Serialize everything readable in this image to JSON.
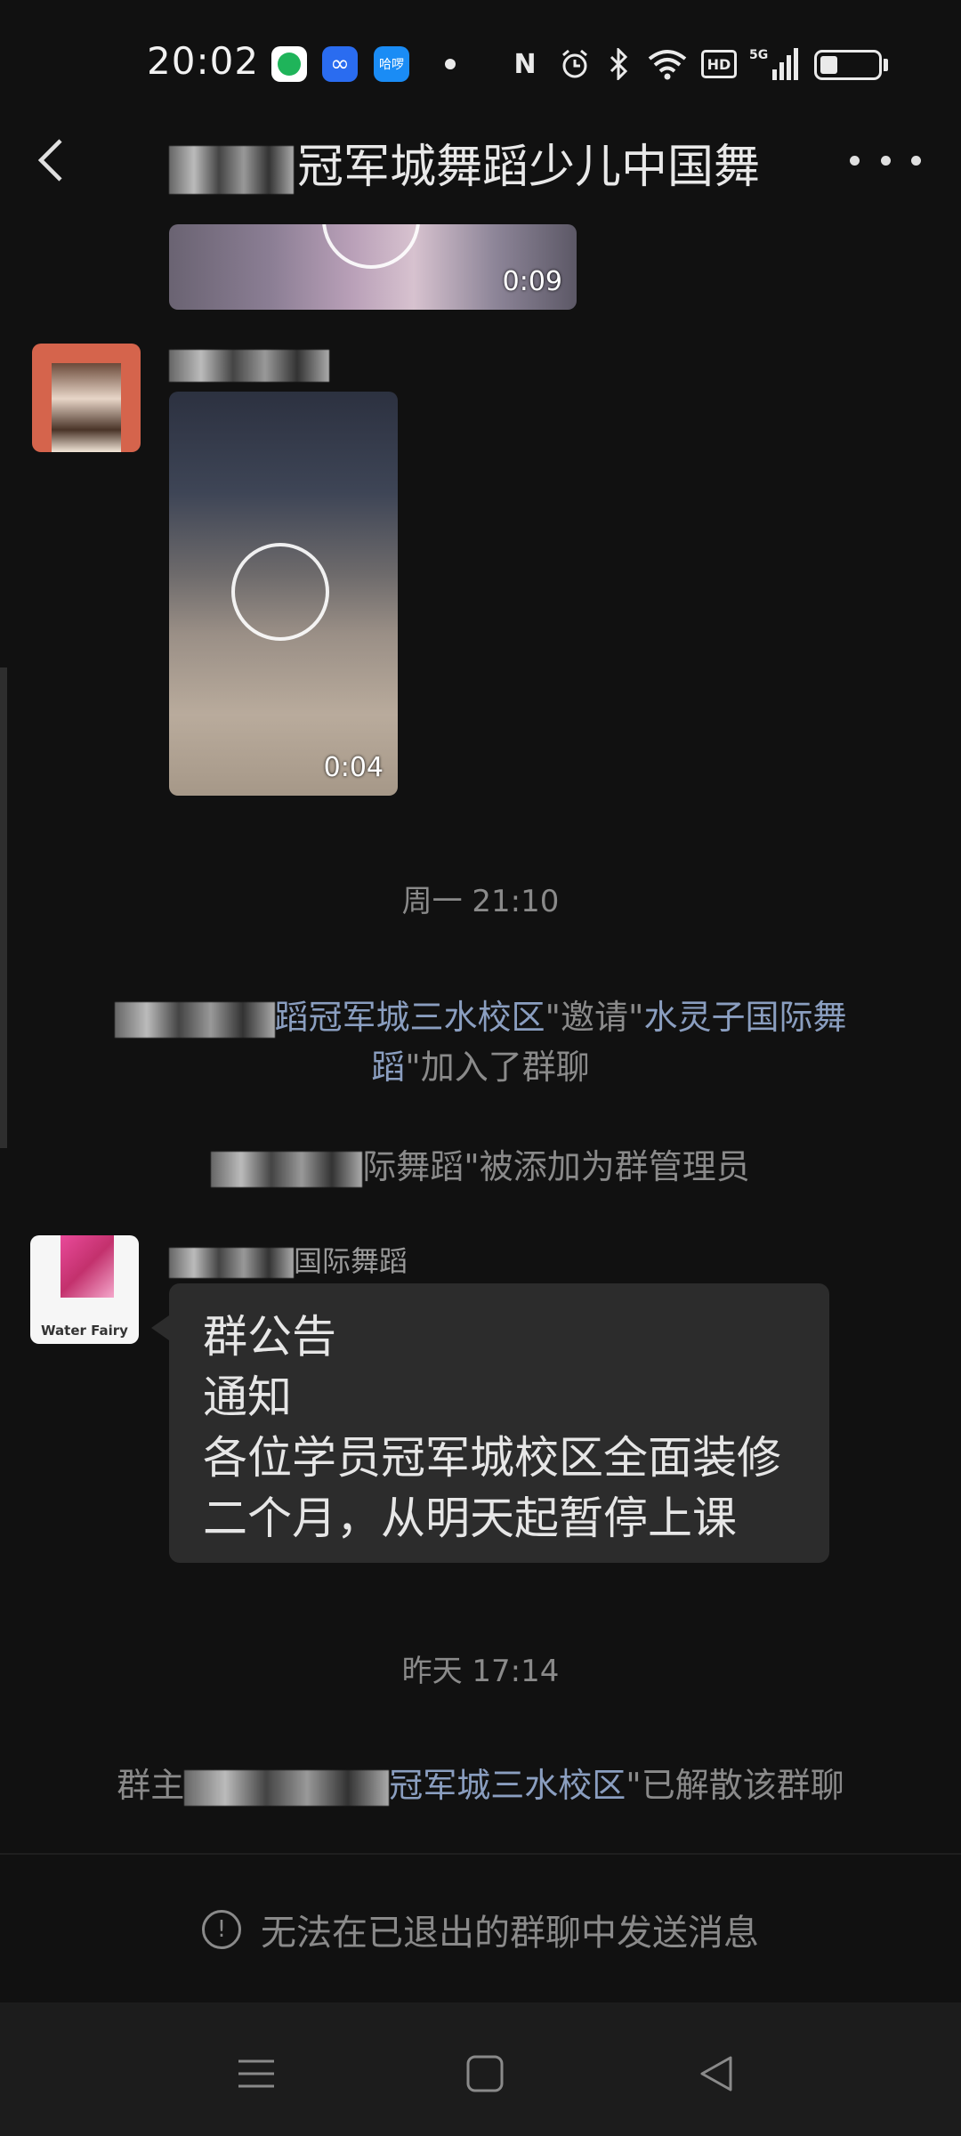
{
  "status_bar": {
    "time": "20:02",
    "app_icons": [
      "message-app-icon",
      "infinity-app-icon",
      "halo-app-icon"
    ],
    "halo_label": "哈啰",
    "hd_label": "HD",
    "network_label": "5G",
    "battery_level": 0.3
  },
  "header": {
    "title_suffix": "冠军城舞蹈少儿中国舞",
    "back_icon": "chevron-left-icon",
    "more_icon": "more-dots-icon"
  },
  "messages": {
    "video_1_duration": "0:09",
    "video_2_duration": "0:04",
    "time_1": "周一 21:10",
    "invite_part_1": "蹈冠军城三水校区",
    "invite_quote_1": "\"邀请\"",
    "invite_part_2": "水灵子国际舞蹈",
    "invite_suffix": "\"加入了群聊",
    "admin_part": "际舞蹈",
    "admin_suffix": "\"被添加为群管理员",
    "sender_2_suffix": "国际舞蹈",
    "avatar_2_caption": "Water Fairy",
    "announcement": [
      "群公告",
      "通知",
      "各位学员冠军城校区全面装修",
      "二个月，从明天起暂停上课"
    ],
    "time_2": "昨天 17:14",
    "dissolve_prefix": "群主",
    "dissolve_part": "冠军城三水校区",
    "dissolve_suffix": "\"已解散该群聊"
  },
  "footer": {
    "exit_notice": "无法在已退出的群聊中发送消息"
  },
  "colors": {
    "background": "#111111",
    "highlight": "#8a9ec0",
    "bubble": "#2c2c2c",
    "system_text": "#8a8a8a"
  }
}
